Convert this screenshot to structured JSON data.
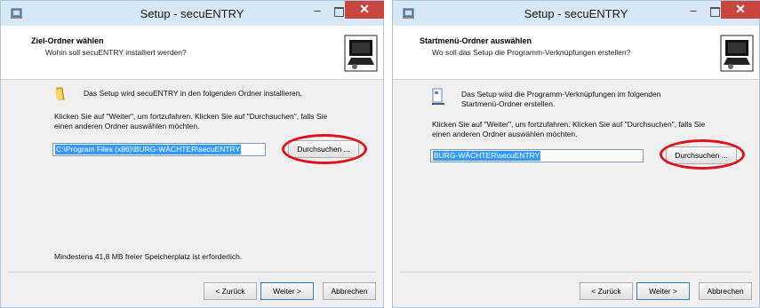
{
  "colors": {
    "highlight": "#e0121b",
    "selection": "#3399ff",
    "close": "#c7463d",
    "titlebar": "#d6e7f5"
  },
  "window1": {
    "title": "Setup - secuENTRY",
    "heading": "Ziel-Ordner wählen",
    "subheading": "Wohin soll secuENTRY installiert werden?",
    "intro": "Das Setup wird secuENTRY in den folgenden Ordner installieren.",
    "instruction_line1": "Klicken Sie auf \"Weiter\", um fortzufahren. Klicken Sie auf \"Durchsuchen\", falls Sie",
    "instruction_line2": "einen anderen Ordner auswählen möchten.",
    "path_value": "C:\\Program Files (x86)\\BURG-WÄCHTER\\secuENTRY",
    "browse_label": "Durchsuchen ...",
    "space_text": "Mindestens 41,8 MB freier Speicherplatz ist erforderlich.",
    "back_label": "< Zurück",
    "next_label": "Weiter >",
    "cancel_label": "Abbrechen",
    "minimize_symbol": "–",
    "close_symbol": "✕"
  },
  "window2": {
    "title": "Setup - secuENTRY",
    "heading": "Startmenü-Ordner auswählen",
    "subheading": "Wo soll das Setup die Programm-Verknüpfungen erstellen?",
    "intro_line1": "Das Setup wird die Programm-Verknüpfungen im folgenden",
    "intro_line2": "Startmenü-Ordner erstellen.",
    "instruction_line1": "Klicken Sie auf \"Weiter\", um fortzufahren. Klicken Sie auf \"Durchsuchen\", falls Sie",
    "instruction_line2": "einen anderen Ordner auswählen möchten.",
    "path_value": "BURG-WÄCHTER\\secuENTRY",
    "browse_label": "Durchsuchen ...",
    "back_label": "< Zurück",
    "next_label": "Weiter >",
    "cancel_label": "Abbrechen",
    "minimize_symbol": "–",
    "close_symbol": "✕"
  }
}
